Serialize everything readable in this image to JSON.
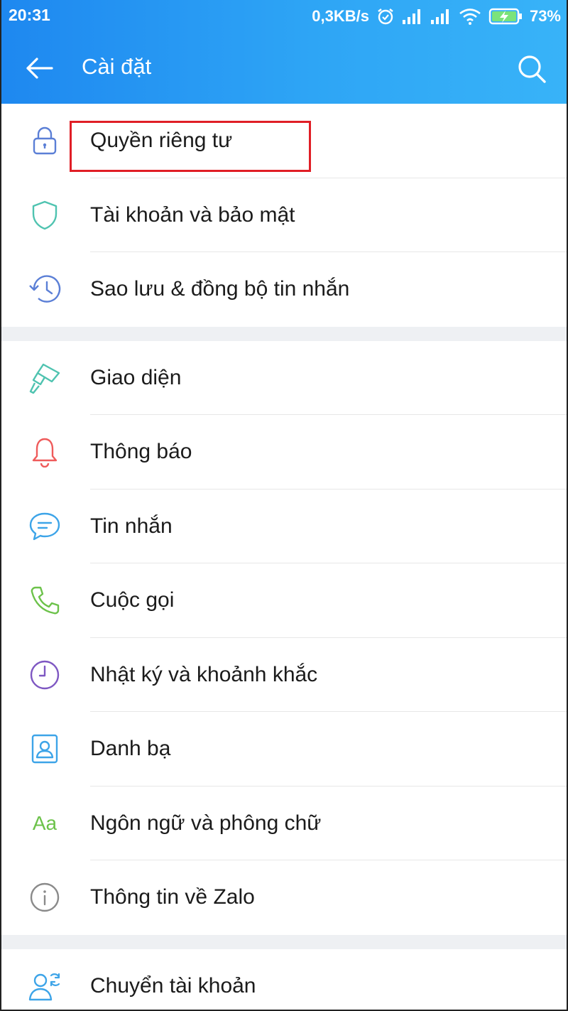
{
  "status_bar": {
    "time": "20:31",
    "net_speed": "0,3KB/s",
    "battery": "73%"
  },
  "header": {
    "title": "Cài đặt",
    "back_icon": "arrow-left-icon",
    "search_icon": "search-icon"
  },
  "groups": [
    {
      "items": [
        {
          "id": "privacy",
          "label": "Quyền riêng tư",
          "icon": "lock-icon",
          "color": "#5b7fd6"
        },
        {
          "id": "account-security",
          "label": "Tài khoản và bảo mật",
          "icon": "shield-icon",
          "color": "#4fc3b0"
        },
        {
          "id": "backup-sync",
          "label": "Sao lưu & đồng bộ tin nhắn",
          "icon": "history-icon",
          "color": "#5b7fd6"
        }
      ]
    },
    {
      "items": [
        {
          "id": "appearance",
          "label": "Giao diện",
          "icon": "paint-brush-icon",
          "color": "#4fc3b0"
        },
        {
          "id": "notifications",
          "label": "Thông báo",
          "icon": "bell-icon",
          "color": "#ef5b5b"
        },
        {
          "id": "messages",
          "label": "Tin nhắn",
          "icon": "chat-bubble-icon",
          "color": "#3da4e8"
        },
        {
          "id": "calls",
          "label": "Cuộc gọi",
          "icon": "phone-icon",
          "color": "#6cc24a"
        },
        {
          "id": "timeline",
          "label": "Nhật ký và khoảnh khắc",
          "icon": "clock-icon",
          "color": "#7e57c2"
        },
        {
          "id": "contacts",
          "label": "Danh bạ",
          "icon": "contact-card-icon",
          "color": "#3da4e8"
        },
        {
          "id": "language-font",
          "label": "Ngôn ngữ và phông chữ",
          "icon": "font-aa-icon",
          "glyph": "Aa",
          "color": "#6cc24a"
        },
        {
          "id": "about",
          "label": "Thông tin về Zalo",
          "icon": "info-icon",
          "color": "#8a8a8a"
        }
      ]
    },
    {
      "items": [
        {
          "id": "switch-account",
          "label": "Chuyển tài khoản",
          "icon": "switch-user-icon",
          "color": "#3da4e8"
        }
      ]
    }
  ],
  "colors": {
    "appbar_start": "#1e88f0",
    "appbar_end": "#38b3f8",
    "highlight_box": "#e01e26"
  }
}
